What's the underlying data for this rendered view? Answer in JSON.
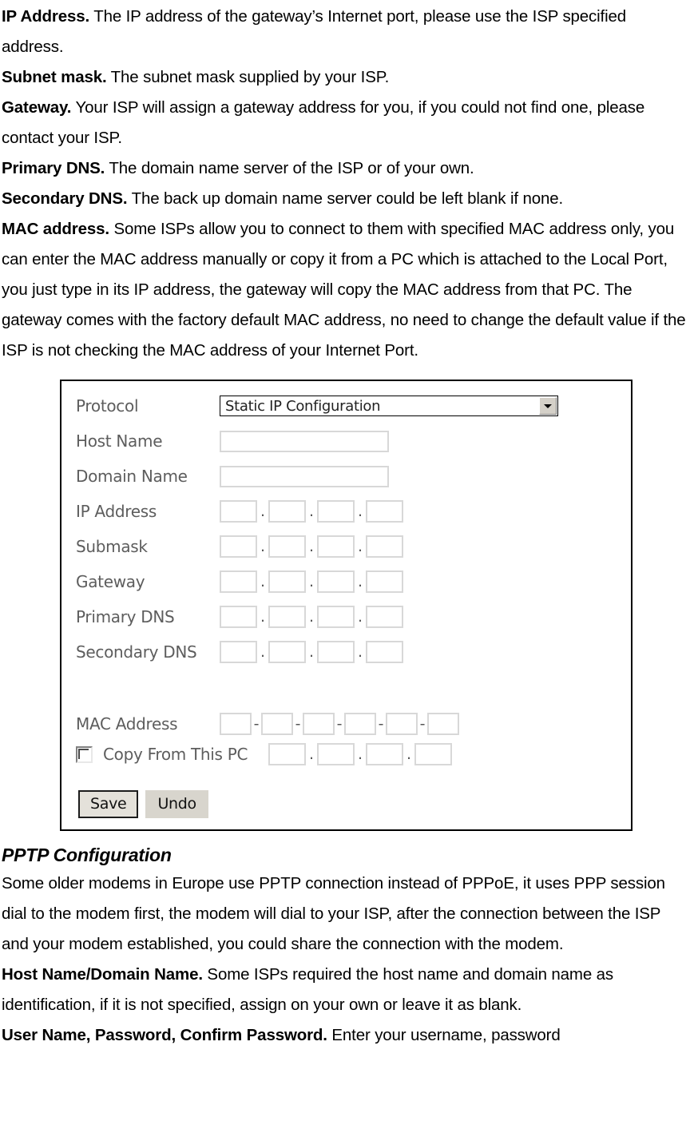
{
  "document": {
    "paragraphs_top": [
      {
        "term": "IP Address.",
        "text": " The IP address of the gateway’s Internet port, please use the ISP specified address."
      },
      {
        "term": "Subnet mask.",
        "text": " The subnet mask supplied by your ISP."
      },
      {
        "term": "Gateway.",
        "text": " Your ISP will assign a gateway address for you, if you could not find one, please contact your ISP."
      },
      {
        "term": "Primary DNS.",
        "text": " The domain name server of the ISP or of your own."
      },
      {
        "term": "Secondary DNS.",
        "text": " The back up domain name server could be left blank if none."
      },
      {
        "term": "MAC address.",
        "text": " Some ISPs allow you to connect to them with specified MAC address only, you can enter the MAC address manually or copy it from a PC which is attached to the Local Port, you just type in its IP address, the gateway will copy the MAC address from that PC. The gateway comes with the factory default MAC address, no need to change the default value if the ISP is not checking the MAC address of your Internet Port."
      }
    ],
    "section_heading": "PPTP Configuration",
    "paragraphs_bottom": [
      {
        "term": "",
        "text": "Some older modems in Europe use PPTP connection instead of PPPoE, it uses PPP session dial to the modem first, the modem will dial to your ISP, after the connection between the ISP and your modem established, you could share the connection with the modem."
      },
      {
        "term": "Host Name/Domain Name.",
        "text": " Some ISPs required the host name and domain name as identification, if it is not specified, assign on your own or leave it as blank."
      },
      {
        "term": "User Name, Password, Confirm Password.",
        "text": " Enter your username, password"
      }
    ]
  },
  "figure": {
    "rows": {
      "protocol_label": "Protocol",
      "host_name_label": "Host Name",
      "domain_name_label": "Domain Name",
      "ip_address_label": "IP Address",
      "submask_label": "Submask",
      "gateway_label": "Gateway",
      "primary_dns_label": "Primary DNS",
      "secondary_dns_label": "Secondary DNS",
      "mac_address_label": "MAC Address",
      "copy_from_pc_label": "Copy From This PC"
    },
    "protocol_select": {
      "value": "Static IP Configuration",
      "options": [
        "Static IP Configuration"
      ]
    },
    "host_name_value": "",
    "domain_name_value": "",
    "ip_address_octets": [
      "",
      "",
      "",
      ""
    ],
    "submask_octets": [
      "",
      "",
      "",
      ""
    ],
    "gateway_octets": [
      "",
      "",
      "",
      ""
    ],
    "primary_dns_octets": [
      "",
      "",
      "",
      ""
    ],
    "secondary_dns_octets": [
      "",
      "",
      "",
      ""
    ],
    "mac_address_octets": [
      "",
      "",
      "",
      "",
      "",
      ""
    ],
    "copy_from_pc_octets": [
      "",
      "",
      "",
      ""
    ],
    "copy_from_pc_checked": false,
    "separators": {
      "dot": ".",
      "dash": "-"
    },
    "buttons": {
      "save_label": "Save",
      "undo_label": "Undo"
    }
  },
  "colors": {
    "text": "#000000",
    "form_label": "#5d5d5d",
    "input_border": "#d8d8d8",
    "button_face": "#d8d5cd",
    "figure_border": "#000000"
  }
}
